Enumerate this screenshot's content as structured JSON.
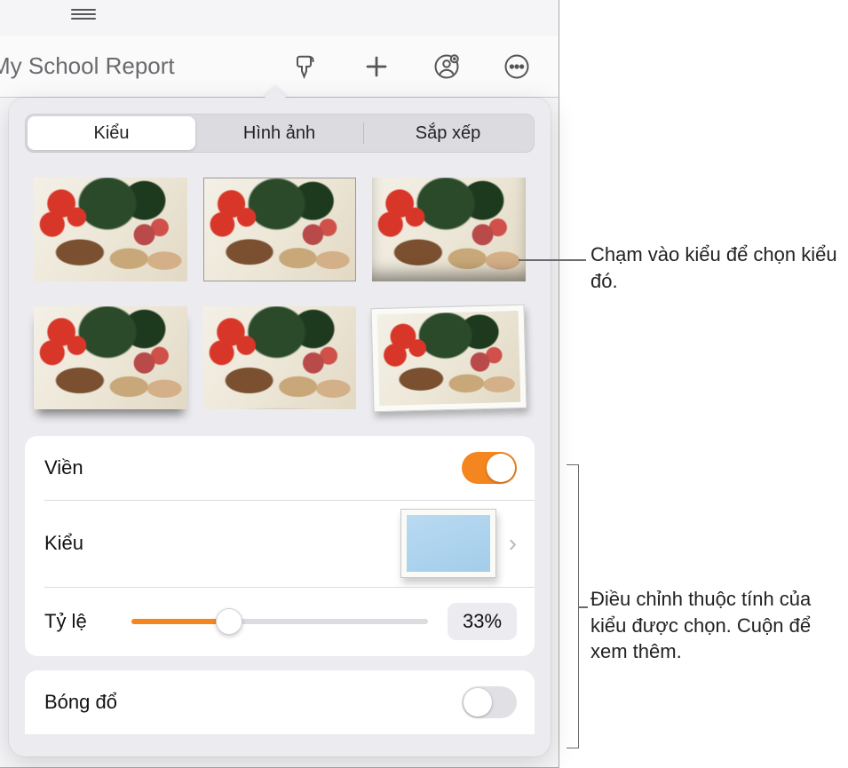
{
  "header": {
    "document_title": "My School Report"
  },
  "popover": {
    "tabs": {
      "style": "Kiểu",
      "image": "Hình ảnh",
      "arrange": "Sắp xếp"
    },
    "border": {
      "label": "Viền",
      "on": true
    },
    "style": {
      "label": "Kiểu"
    },
    "scale": {
      "label": "Tỷ lệ",
      "value_pct": 33,
      "value_display": "33%"
    },
    "shadow": {
      "label": "Bóng đổ",
      "on": false
    }
  },
  "callouts": {
    "top": "Chạm vào kiểu để chọn kiểu đó.",
    "bottom": "Điều chỉnh thuộc tính của kiểu được chọn. Cuộn để xem thêm."
  }
}
